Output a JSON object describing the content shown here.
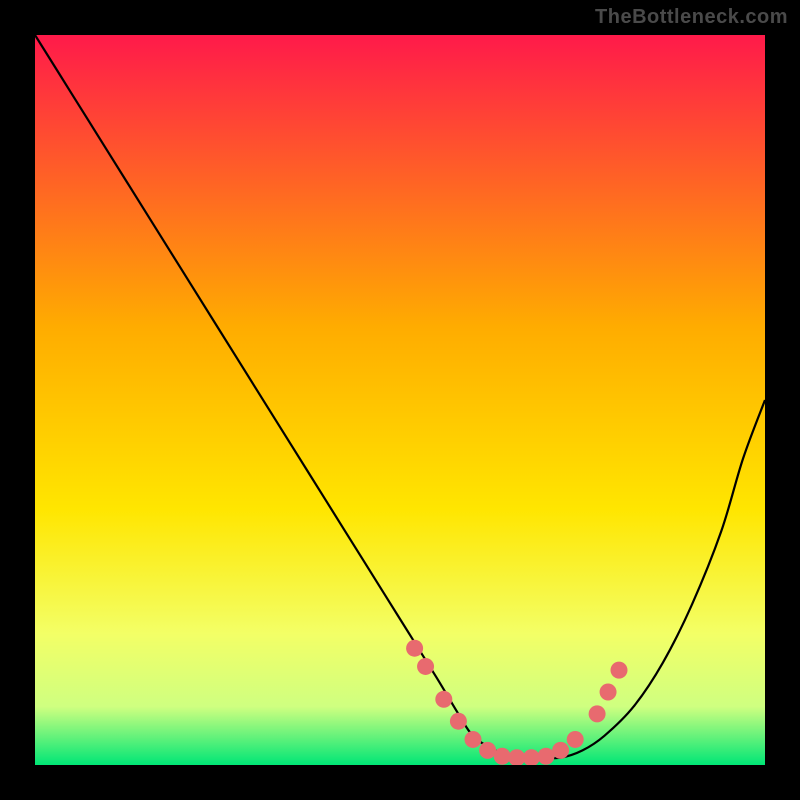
{
  "watermark": "TheBottleneck.com",
  "chart_data": {
    "type": "line",
    "title": "",
    "xlabel": "",
    "ylabel": "",
    "xlim": [
      0,
      100
    ],
    "ylim": [
      0,
      100
    ],
    "gradient_stops": [
      {
        "offset": 0,
        "color": "#ff1a4a"
      },
      {
        "offset": 40,
        "color": "#ffac00"
      },
      {
        "offset": 65,
        "color": "#ffe600"
      },
      {
        "offset": 82,
        "color": "#f3ff66"
      },
      {
        "offset": 92,
        "color": "#cfff80"
      },
      {
        "offset": 100,
        "color": "#00e676"
      }
    ],
    "curve": {
      "x": [
        0,
        5,
        10,
        15,
        20,
        25,
        30,
        35,
        40,
        45,
        50,
        55,
        58,
        60,
        63,
        66,
        69,
        72,
        75,
        78,
        82,
        86,
        90,
        94,
        97,
        100
      ],
      "y": [
        100,
        92,
        84,
        76,
        68,
        60,
        52,
        44,
        36,
        28,
        20,
        12,
        7,
        4,
        2,
        1,
        1,
        1,
        2,
        4,
        8,
        14,
        22,
        32,
        42,
        50
      ]
    },
    "markers": {
      "x": [
        52,
        53.5,
        56,
        58,
        60,
        62,
        64,
        66,
        68,
        70,
        72,
        74,
        77,
        78.5,
        80
      ],
      "y": [
        16,
        13.5,
        9,
        6,
        3.5,
        2,
        1.2,
        1,
        1,
        1.2,
        2,
        3.5,
        7,
        10,
        13
      ]
    }
  }
}
